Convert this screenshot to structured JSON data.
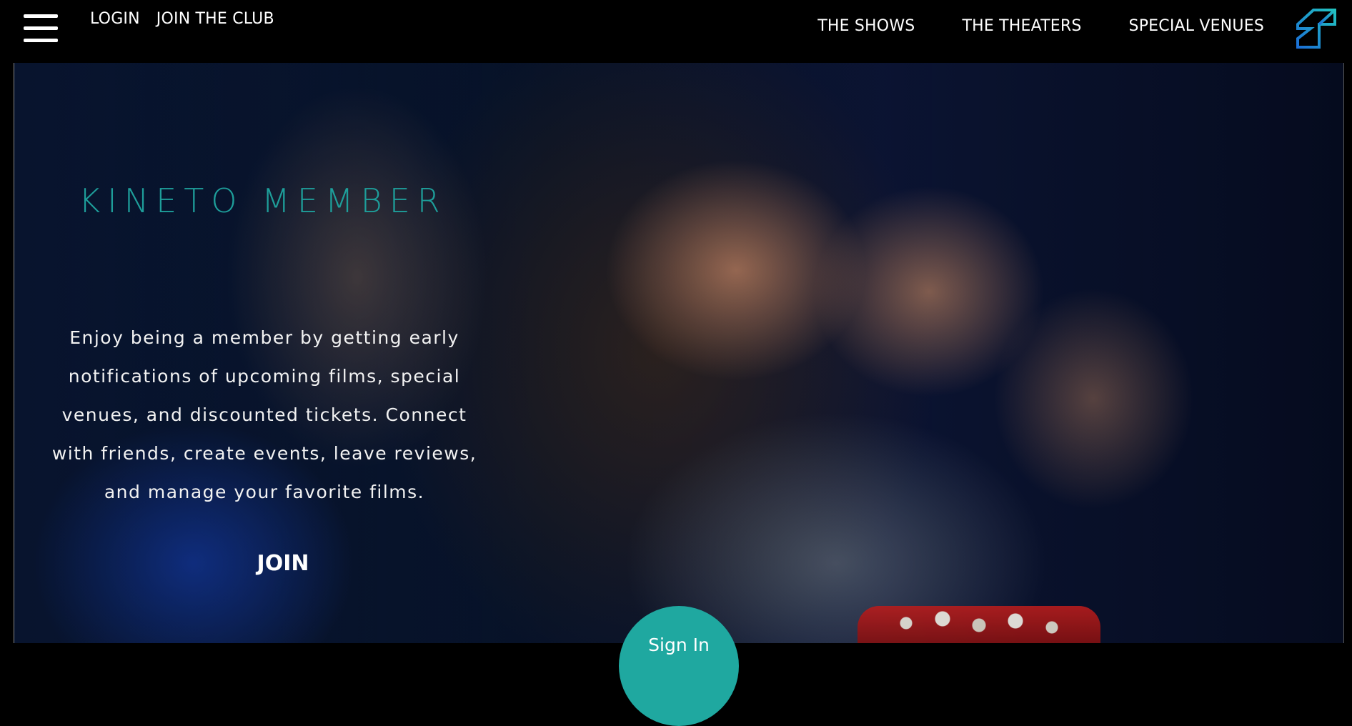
{
  "topbar": {
    "menu_icon": "hamburger-menu-icon",
    "left_links": [
      {
        "label": "LOGIN"
      },
      {
        "label": "JOIN THE CLUB"
      }
    ],
    "right_links": [
      {
        "label": "THE SHOWS"
      },
      {
        "label": "THE THEATERS"
      },
      {
        "label": "SPECIAL VENUES"
      }
    ],
    "logo_icon": "kineto-logo-icon"
  },
  "hero": {
    "title": "KINETO MEMBER",
    "description": "Enjoy being a member by getting early notifications of upcoming films, special venues, and discounted tickets. Connect with friends, create events, leave reviews, and manage your favorite films.",
    "join_label": "JOIN",
    "signin_label": "Sign In"
  },
  "colors": {
    "accent": "#1e9e9a",
    "signin_bg": "#1fa8a0",
    "logo_blue": "#1b6fd6",
    "logo_teal": "#22c3c0"
  }
}
